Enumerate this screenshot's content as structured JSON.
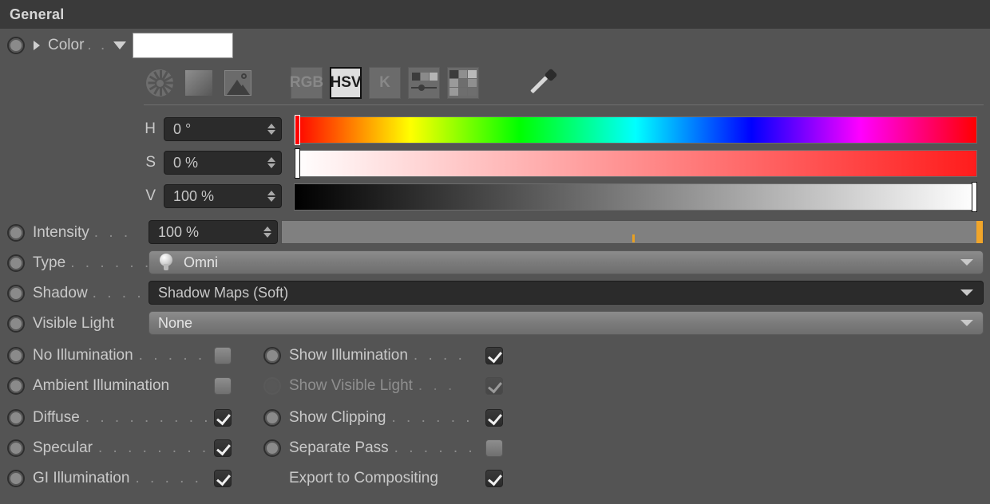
{
  "header": {
    "title": "General"
  },
  "color": {
    "label": "Color",
    "dots": ". .",
    "swatch_hex": "#ffffff",
    "expand_icon": "triangle-right-icon",
    "dropdown_icon": "triangle-down-icon"
  },
  "picker_toolbar": {
    "buttons": [
      {
        "name": "color-wheel-mode",
        "label": "",
        "icon": "color-wheel-icon",
        "selected": false
      },
      {
        "name": "gradient-mode",
        "label": "",
        "icon": "gradient-square-icon",
        "selected": false
      },
      {
        "name": "image-mode",
        "label": "",
        "icon": "picture-icon",
        "selected": false
      },
      {
        "name": "rgb-mode",
        "label": "RGB",
        "icon": "text-icon",
        "selected": false
      },
      {
        "name": "hsv-mode",
        "label": "HSV",
        "icon": "text-icon",
        "selected": true
      },
      {
        "name": "kelvin-mode",
        "label": "K",
        "icon": "text-icon",
        "selected": false
      },
      {
        "name": "mixer-mode",
        "label": "",
        "icon": "slider-swatch-icon",
        "selected": false
      },
      {
        "name": "swatches-mode",
        "label": "",
        "icon": "checker-swatch-icon",
        "selected": false
      },
      {
        "name": "eyedropper",
        "label": "",
        "icon": "eyedropper-icon",
        "selected": false
      }
    ]
  },
  "hsv": [
    {
      "key": "H",
      "value": "0 °",
      "handle_pct": 0,
      "handle_color": "#ff0000"
    },
    {
      "key": "S",
      "value": "0 %",
      "handle_pct": 0,
      "handle_color": "#ffffff"
    },
    {
      "key": "V",
      "value": "100 %",
      "handle_pct": 100,
      "handle_color": "#ffffff"
    }
  ],
  "fields": {
    "intensity": {
      "label": "Intensity",
      "dots": ". . .",
      "value": "100 %",
      "slider_pct": 100,
      "tick_pct": 50
    },
    "type": {
      "label": "Type",
      "dots": ". . . . . . .",
      "value": "Omni",
      "icon": "light-bulb-icon"
    },
    "shadow": {
      "label": "Shadow",
      "dots": ". . . .",
      "value": "Shadow Maps (Soft)"
    },
    "visible_light": {
      "label": "Visible Light",
      "dots": "",
      "value": "None"
    }
  },
  "checkboxes_left": [
    {
      "label": "No Illumination",
      "dots": ". . . . .",
      "checked": false,
      "enabled": true
    },
    {
      "label": "Ambient Illumination",
      "dots": "",
      "checked": false,
      "enabled": true
    },
    {
      "label": "Diffuse",
      "dots": ". . . . . . . . . .",
      "checked": true,
      "enabled": true
    },
    {
      "label": "Specular",
      "dots": ". . . . . . . . .",
      "checked": true,
      "enabled": true
    },
    {
      "label": "GI Illumination",
      "dots": ". . . . .",
      "checked": true,
      "enabled": true
    }
  ],
  "checkboxes_right": [
    {
      "label": "Show Illumination",
      "dots": ". . . .",
      "checked": true,
      "enabled": true,
      "bullet": true
    },
    {
      "label": "Show Visible Light",
      "dots": ". . .",
      "checked": true,
      "enabled": false,
      "bullet": true
    },
    {
      "label": "Show Clipping",
      "dots": ". . . . . .",
      "checked": true,
      "enabled": true,
      "bullet": true
    },
    {
      "label": "Separate Pass",
      "dots": ". . . . . .",
      "checked": false,
      "enabled": true,
      "bullet": true
    },
    {
      "label": "Export to Compositing",
      "dots": "",
      "checked": true,
      "enabled": true,
      "bullet": false
    }
  ],
  "colors": {
    "panel_bg": "#545454",
    "header_bg": "#3a3a3a",
    "accent_orange": "#f0a52a",
    "field_dark": "#2b2b2b",
    "text": "#c9c9c9"
  }
}
